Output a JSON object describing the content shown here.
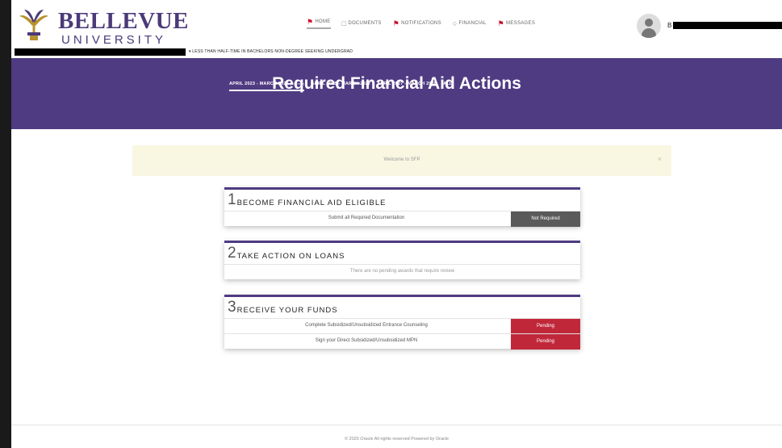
{
  "logo": {
    "name": "BELLEVUE",
    "sub": "UNIVERSITY"
  },
  "status_line": "▾ LESS THAN HALF-TIME IN BACHELORS NON-DEGREE SEEKING UNDERGRAD",
  "user_initial": "B",
  "nav": [
    {
      "label": "HOME",
      "icon": "home-icon"
    },
    {
      "label": "DOCUMENTS",
      "icon": "document-icon"
    },
    {
      "label": "NOTIFICATIONS",
      "icon": "bell-icon"
    },
    {
      "label": "FINANCIAL",
      "icon": "dollar-icon"
    },
    {
      "label": "MESSAGES",
      "icon": "envelope-icon"
    }
  ],
  "banner": {
    "title": "Required Financial Aid Actions",
    "tabs": [
      {
        "label": "APRIL 2023 - MARCH 2025",
        "current": "(Current)"
      },
      {
        "label": "APRIL 2025 - MARCH 2027",
        "current": ""
      },
      {
        "label": "APRIL 2027 - MARCH 2028",
        "current": ""
      },
      {
        "label": "ALL",
        "current": ""
      }
    ]
  },
  "alert": {
    "text": "Welcome to SFP",
    "close": "×"
  },
  "steps": [
    {
      "num": "1",
      "title": "BECOME FINANCIAL AID ELIGIBLE",
      "rows": [
        {
          "label": "Submit all Required Documentation",
          "status": "Not Required"
        }
      ]
    },
    {
      "num": "2",
      "title": "TAKE ACTION ON LOANS",
      "rows": [
        {
          "label": "There are no pending awards that require review"
        }
      ]
    },
    {
      "num": "3",
      "title": "RECEIVE YOUR FUNDS",
      "rows": [
        {
          "label": "Complete Subsidized/Unsubsidized Entrance Counseling",
          "status": "Pending"
        },
        {
          "label": "Sign your Direct Subsidized/Unsubsidized MPN",
          "status": "Pending"
        }
      ]
    }
  ],
  "footer": "© 2025 Oracle All rights reserved Powered by Oracle",
  "colors": {
    "brand": "#4f3b82",
    "pending": "#c0283a",
    "not_required": "#5a5a5a",
    "alert_bg": "#f9f7e2"
  }
}
